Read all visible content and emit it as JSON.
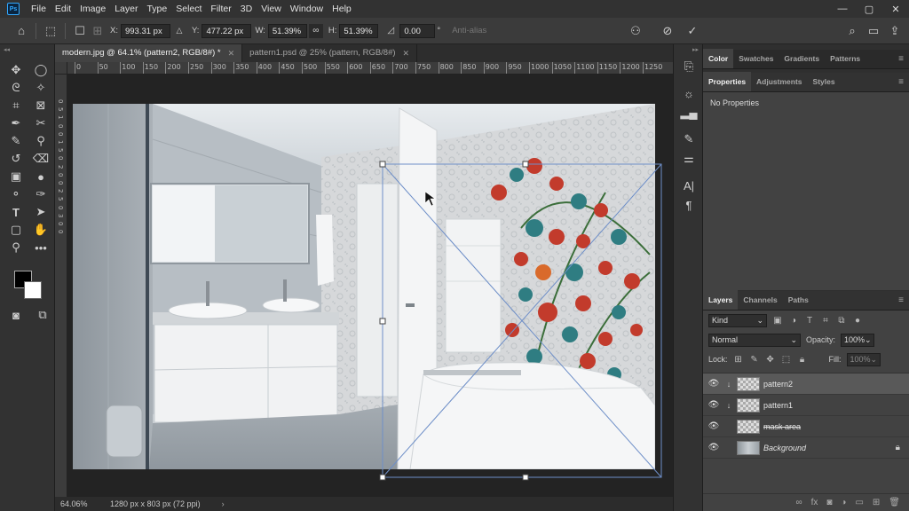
{
  "menu": [
    "File",
    "Edit",
    "Image",
    "Layer",
    "Type",
    "Select",
    "Filter",
    "3D",
    "View",
    "Window",
    "Help"
  ],
  "window_controls": {
    "minimize": "—",
    "maximize": "▢",
    "close": "✕"
  },
  "options": {
    "x_label": "X:",
    "x_value": "993.31 px",
    "y_label": "Y:",
    "y_value": "477.22 px",
    "w_label": "W:",
    "w_value": "51.39%",
    "h_label": "H:",
    "h_value": "51.39%",
    "angle_value": "0.00",
    "angle_unit": "°",
    "antialias_label": "Anti-alias"
  },
  "tabs": [
    {
      "label": "modern.jpg @ 64.1% (pattern2, RGB/8#) *",
      "active": true
    },
    {
      "label": "pattern1.psd @ 25% (pattern, RGB/8#)",
      "active": false
    }
  ],
  "ruler_h": [
    "0",
    "50",
    "100",
    "150",
    "200",
    "250",
    "300",
    "350",
    "400",
    "450",
    "500",
    "550",
    "600",
    "650",
    "700",
    "750",
    "800",
    "850",
    "900",
    "950",
    "1000",
    "1050",
    "1100",
    "1150",
    "1200",
    "1250"
  ],
  "ruler_v": [
    "0",
    "5",
    "1",
    "0",
    "0",
    "1",
    "5",
    "0",
    "2",
    "0",
    "0",
    "2",
    "5",
    "0",
    "3",
    "0",
    "0"
  ],
  "status": {
    "zoom": "64.06%",
    "doc_size": "1280 px x 803 px (72 ppi)",
    "arrow": "›"
  },
  "color_panel_tabs": [
    "Color",
    "Swatches",
    "Gradients",
    "Patterns"
  ],
  "props_panel_tabs": [
    "Properties",
    "Adjustments",
    "Styles"
  ],
  "no_properties": "No Properties",
  "layers_panel_tabs": [
    "Layers",
    "Channels",
    "Paths"
  ],
  "layers_filter": "Kind",
  "blend_mode": "Normal",
  "opacity_label": "Opacity:",
  "opacity_value": "100%",
  "lock_label": "Lock:",
  "fill_label": "Fill:",
  "fill_value": "100%",
  "layers": [
    {
      "name": "pattern2",
      "selected": true,
      "clipped": true
    },
    {
      "name": "pattern1",
      "selected": false,
      "clipped": true
    },
    {
      "name": "mask area",
      "selected": false,
      "clipped": false,
      "strike": true
    },
    {
      "name": "Background",
      "selected": false,
      "clipped": false,
      "italic": true,
      "locked": true
    }
  ],
  "colors": {
    "accent": "#31a8ff",
    "foreground": "#000000",
    "background": "#ffffff",
    "transform_box": "#6e8fc8"
  }
}
